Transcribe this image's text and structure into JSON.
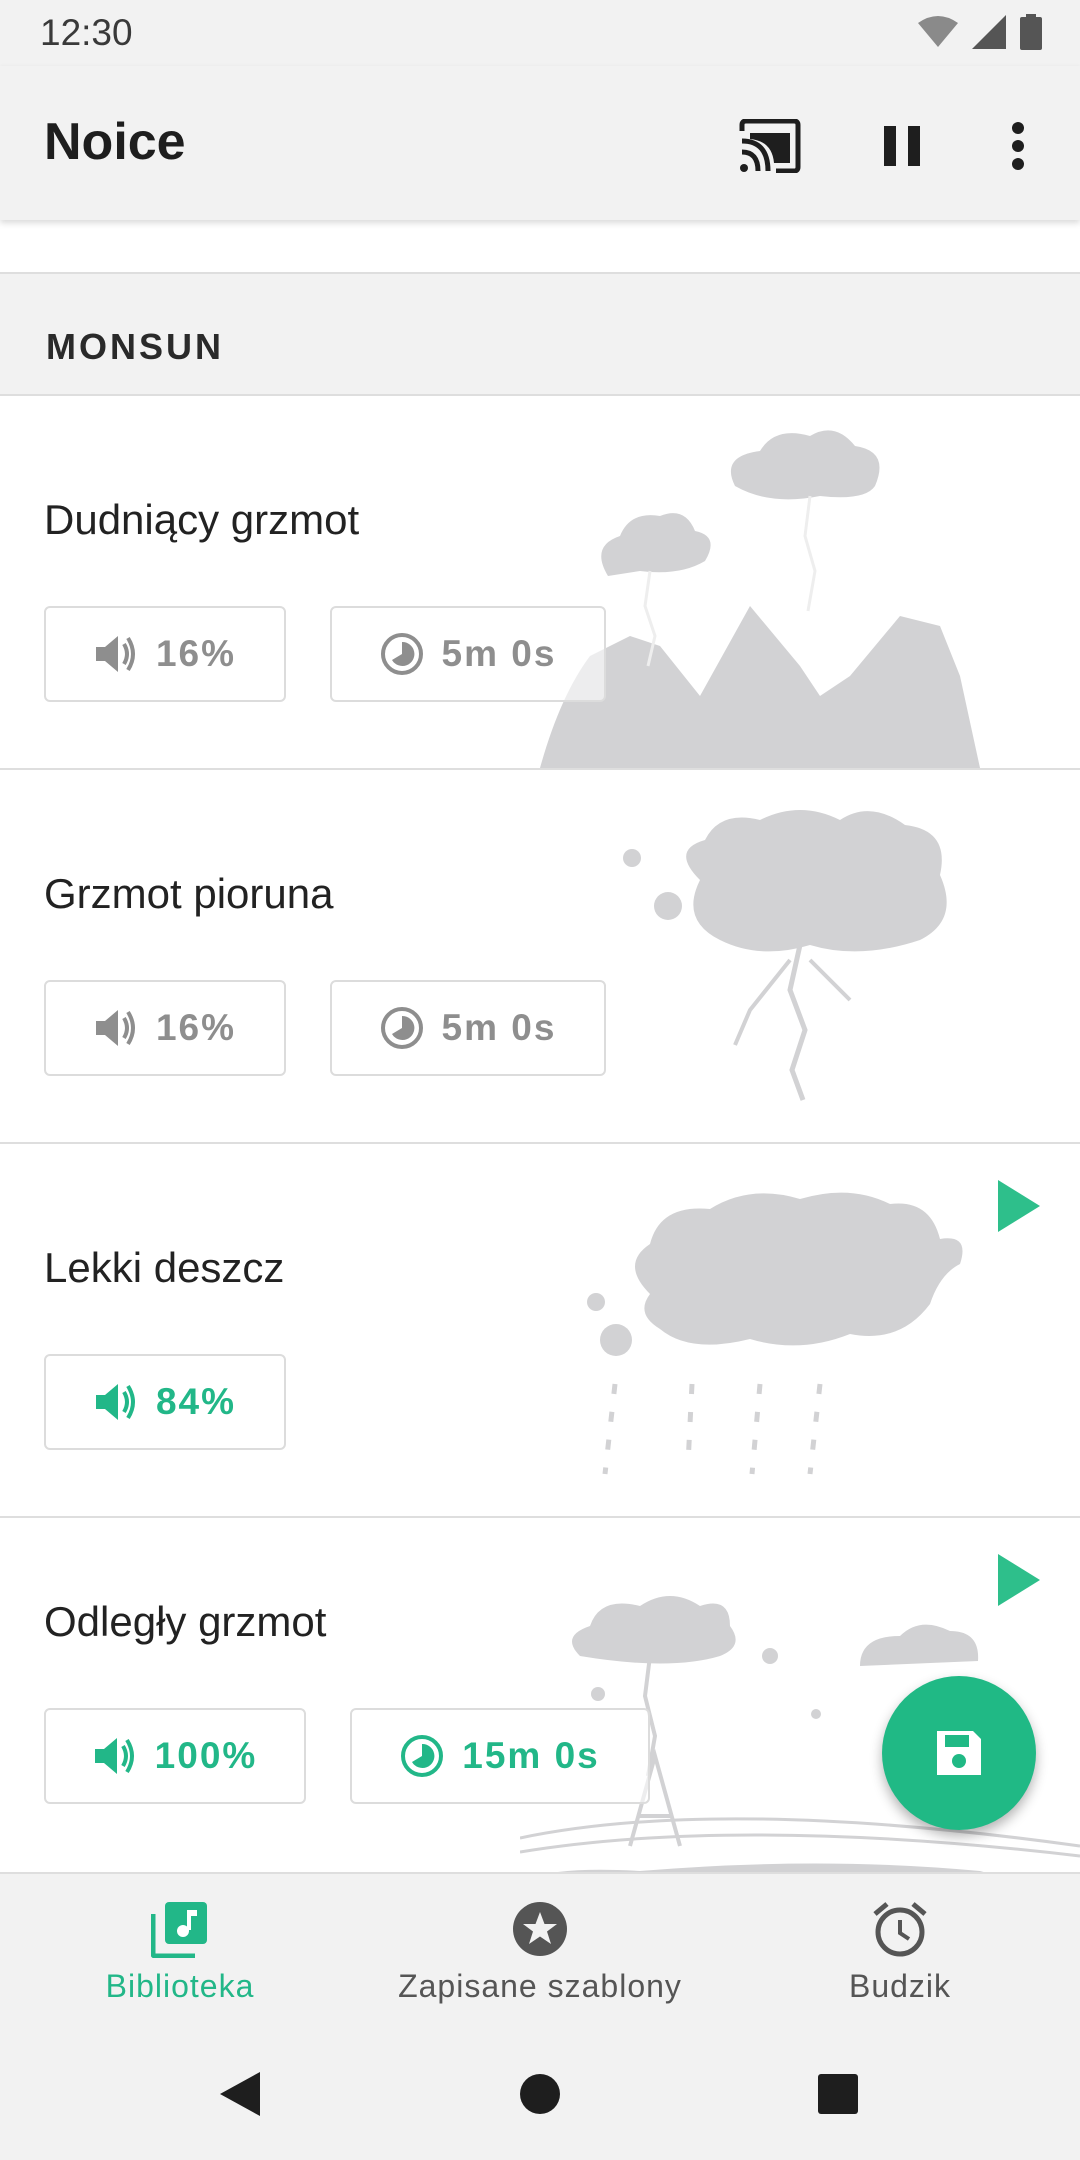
{
  "status_bar": {
    "time": "12:30"
  },
  "app_bar": {
    "title": "Noice",
    "actions": [
      "cast-icon",
      "pause-icon",
      "more-vert-icon"
    ]
  },
  "section": {
    "title": "MONSUN"
  },
  "cards": [
    {
      "title": "Dudniący grzmot",
      "volume": "16%",
      "timer": "5m 0s",
      "playing": false
    },
    {
      "title": "Grzmot pioruna",
      "volume": "16%",
      "timer": "5m 0s",
      "playing": false
    },
    {
      "title": "Lekki deszcz",
      "volume": "84%",
      "playing": true
    },
    {
      "title": "Odległy grzmot",
      "volume": "100%",
      "timer": "15m 0s",
      "playing": true
    }
  ],
  "fab": {
    "icon": "save-icon"
  },
  "bottom_nav": [
    {
      "label": "Biblioteka",
      "icon": "library-music-icon",
      "active": true
    },
    {
      "label": "Zapisane szablony",
      "icon": "star-circle-icon",
      "active": false
    },
    {
      "label": "Budzik",
      "icon": "alarm-icon",
      "active": false
    }
  ],
  "system_nav": [
    "back-icon",
    "home-icon",
    "recents-icon"
  ],
  "colors": {
    "accent": "#22b788",
    "inactive": "#8e8e8e",
    "illustration": "#d2d2d4",
    "bar_bg": "#f2f2f2"
  }
}
